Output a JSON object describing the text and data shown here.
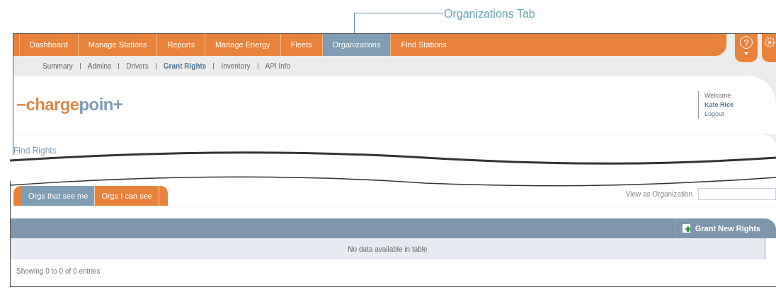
{
  "callout": {
    "label": "Organizations Tab"
  },
  "nav_tabs": [
    {
      "label": "Dashboard",
      "selected": false
    },
    {
      "label": "Manage Stations",
      "selected": false
    },
    {
      "label": "Reports",
      "selected": false
    },
    {
      "label": "Manage Energy",
      "selected": false
    },
    {
      "label": "Fleets",
      "selected": false
    },
    {
      "label": "Organizations",
      "selected": true
    },
    {
      "label": "Find Stations",
      "selected": false
    }
  ],
  "help_button": {
    "label": "?"
  },
  "sub_nav": [
    {
      "label": "Summary",
      "selected": false
    },
    {
      "label": "Admins",
      "selected": false
    },
    {
      "label": "Drivers",
      "selected": false
    },
    {
      "label": "Grant Rights",
      "selected": true
    },
    {
      "label": "Inventory",
      "selected": false
    },
    {
      "label": "API Info",
      "selected": false
    }
  ],
  "logo": {
    "parts": [
      "−charge",
      "poin+"
    ]
  },
  "user_panel": {
    "greeting": "Welcome",
    "user": "Kate Rice",
    "logout": "Logout"
  },
  "section_title": "Find Rights",
  "org_tabs": [
    {
      "label": "Orgs that see me",
      "selected": true
    },
    {
      "label": "Orgs I can see",
      "selected": false
    }
  ],
  "view_as": {
    "label": "View as Organization"
  },
  "table": {
    "action": "Grant New Rights",
    "empty_message": "No data available in table",
    "info": "Showing 0 to 0 of 0 entries"
  }
}
